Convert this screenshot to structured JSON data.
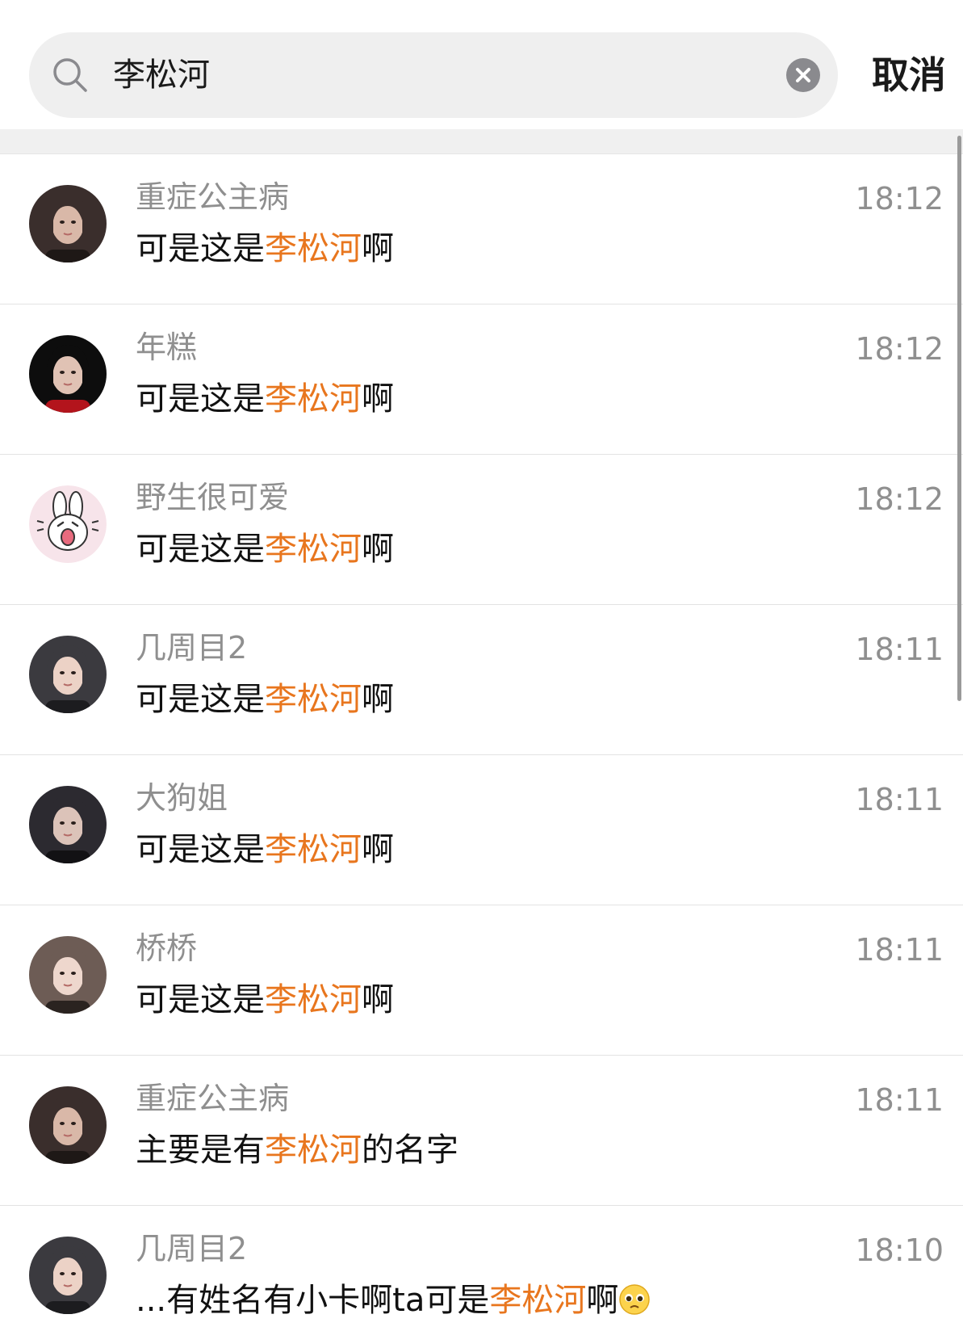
{
  "search": {
    "query": "李松河",
    "cancel_label": "取消"
  },
  "colors": {
    "highlight": "#e8761e",
    "name_gray": "#8f8f8f",
    "search_bg": "#efefef"
  },
  "results": [
    {
      "name": "重症公主病",
      "time": "18:12",
      "msg_before": "可是这是",
      "msg_highlight": "李松河",
      "msg_after": "啊",
      "avatar": "photo-avatar"
    },
    {
      "name": "年糕",
      "time": "18:12",
      "msg_before": "可是这是",
      "msg_highlight": "李松河",
      "msg_after": "啊",
      "avatar": "photo-avatar-red"
    },
    {
      "name": "野生很可爱",
      "time": "18:12",
      "msg_before": "可是这是",
      "msg_highlight": "李松河",
      "msg_after": "啊",
      "avatar": "cartoon-bunny-avatar"
    },
    {
      "name": "几周目2",
      "time": "18:11",
      "msg_before": "可是这是",
      "msg_highlight": "李松河",
      "msg_after": "啊",
      "avatar": "photo-avatar"
    },
    {
      "name": "大狗姐",
      "time": "18:11",
      "msg_before": "可是这是",
      "msg_highlight": "李松河",
      "msg_after": "啊",
      "avatar": "photo-avatar"
    },
    {
      "name": "桥桥",
      "time": "18:11",
      "msg_before": "可是这是",
      "msg_highlight": "李松河",
      "msg_after": "啊",
      "avatar": "photo-avatar"
    },
    {
      "name": "重症公主病",
      "time": "18:11",
      "msg_before": "主要是有",
      "msg_highlight": "李松河",
      "msg_after": "的名字",
      "avatar": "photo-avatar"
    },
    {
      "name": "几周目2",
      "time": "18:10",
      "msg_before": "...有姓名有小卡啊ta可是",
      "msg_highlight": "李松河",
      "msg_after": "啊",
      "avatar": "photo-avatar",
      "emoji": "pleading-face-emoji"
    }
  ]
}
